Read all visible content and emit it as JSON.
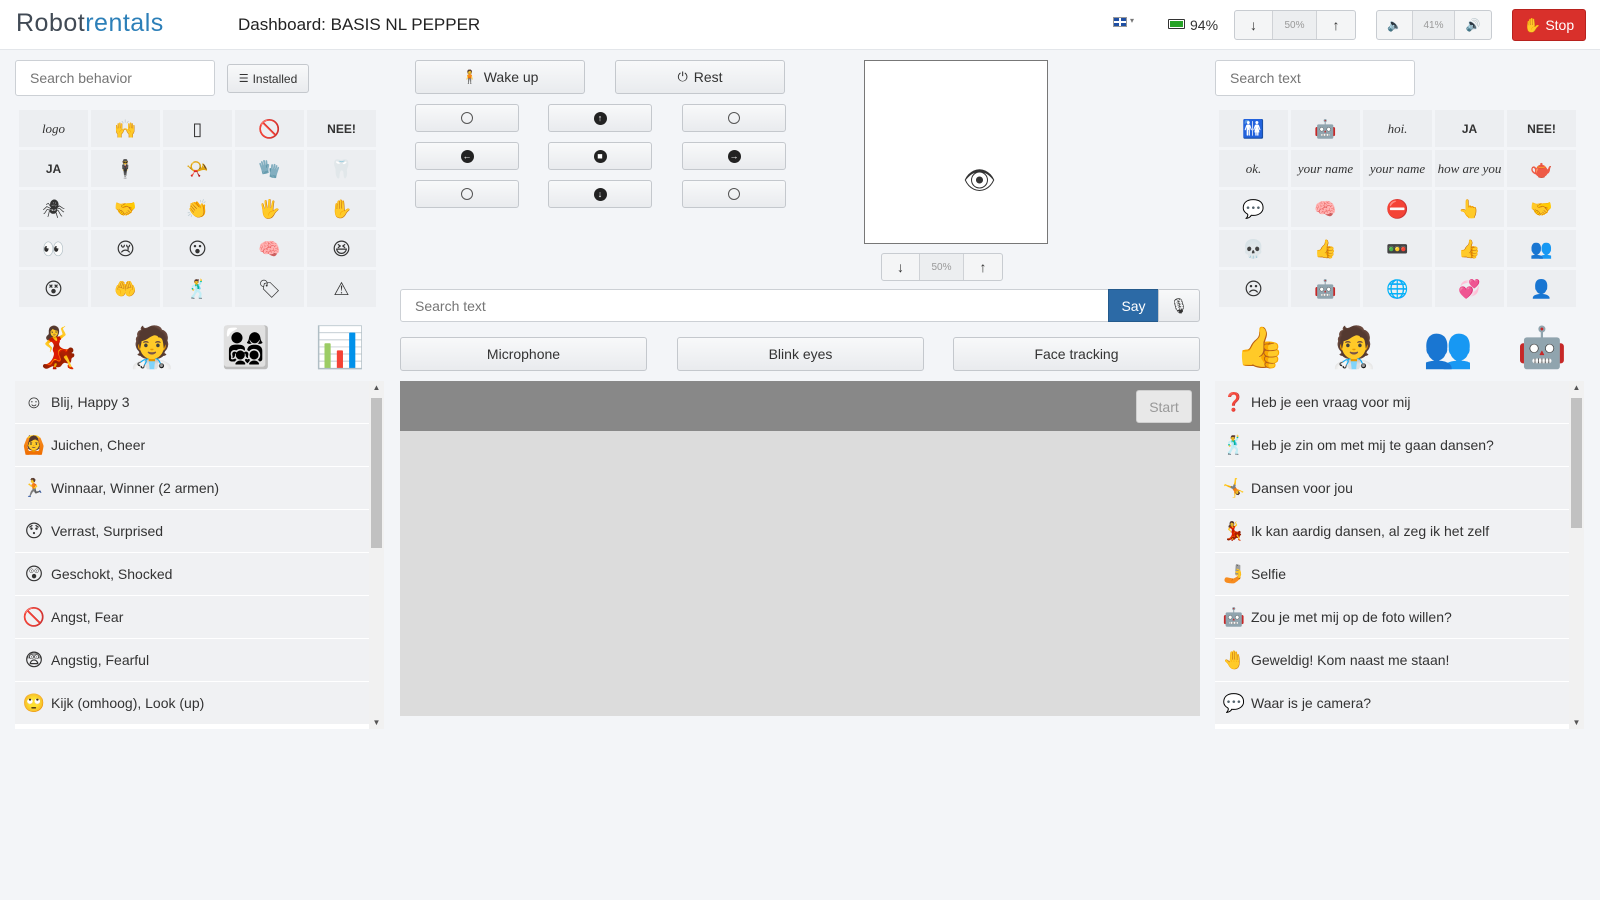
{
  "header": {
    "logo_part1": "Robot",
    "logo_part2": "rentals",
    "title": "Dashboard: BASIS NL PEPPER",
    "battery_percent": "94%",
    "head_tilt_value": "50%",
    "volume_value": "41%",
    "stop_label": "Stop"
  },
  "left": {
    "search_placeholder": "Search behavior",
    "installed_label": "Installed",
    "grid": [
      {
        "icon": "logo-icon",
        "kind": "script",
        "text": "logo"
      },
      {
        "icon": "arms-up-robot-icon",
        "kind": "glyph",
        "text": "🙌"
      },
      {
        "icon": "tablet-icon",
        "kind": "glyph",
        "text": "▯"
      },
      {
        "icon": "forbidden-icon",
        "kind": "glyph",
        "text": "🚫"
      },
      {
        "icon": "nee-icon",
        "kind": "txt",
        "text": "NEE!"
      },
      {
        "icon": "ja-icon",
        "kind": "txt",
        "text": "JA"
      },
      {
        "icon": "person-arms-out-icon",
        "kind": "glyph",
        "text": "🕴"
      },
      {
        "icon": "whistle-icon",
        "kind": "glyph",
        "text": "📯"
      },
      {
        "icon": "hands-icon",
        "kind": "glyph",
        "text": "🧤"
      },
      {
        "icon": "teeth-icon",
        "kind": "glyph",
        "text": "🦷"
      },
      {
        "icon": "bug-icon",
        "kind": "glyph",
        "text": "🕷"
      },
      {
        "icon": "handshake-icon",
        "kind": "glyph",
        "text": "🤝"
      },
      {
        "icon": "clap-hand-icon",
        "kind": "glyph",
        "text": "👏"
      },
      {
        "icon": "wave-hand-icon",
        "kind": "glyph",
        "text": "🖐"
      },
      {
        "icon": "open-hand-icon",
        "kind": "glyph",
        "text": "✋"
      },
      {
        "icon": "eyes-icon",
        "kind": "glyph",
        "text": "👀"
      },
      {
        "icon": "crying-face-icon",
        "kind": "glyph",
        "text": "😢"
      },
      {
        "icon": "orange-face-icon",
        "kind": "glyph",
        "text": "😮"
      },
      {
        "icon": "brain-icon",
        "kind": "glyph",
        "text": "🧠"
      },
      {
        "icon": "laughing-face-icon",
        "kind": "glyph",
        "text": "😆"
      },
      {
        "icon": "blue-face-icon",
        "kind": "glyph",
        "text": "😵"
      },
      {
        "icon": "handshake-hands-icon",
        "kind": "glyph",
        "text": "🤲"
      },
      {
        "icon": "person-stand-icon",
        "kind": "glyph",
        "text": "🕺"
      },
      {
        "icon": "sign-icon",
        "kind": "glyph",
        "text": "🏷"
      },
      {
        "icon": "warning-icon",
        "kind": "glyph",
        "text": "⚠"
      }
    ],
    "big_icons": [
      {
        "icon": "dancing-couple-icon",
        "text": "💃"
      },
      {
        "icon": "doctor-patient-icon",
        "text": "🧑‍⚕️"
      },
      {
        "icon": "group-people-icon",
        "text": "👨‍👩‍👧‍👦"
      },
      {
        "icon": "presentation-icon",
        "text": "📊"
      }
    ],
    "list": [
      {
        "icon": "happy-face-icon",
        "glyph": "☺",
        "label": "Blij, Happy 3"
      },
      {
        "icon": "cheer-icon",
        "glyph": "🙆",
        "label": "Juichen, Cheer"
      },
      {
        "icon": "winner-icon",
        "glyph": "🏃",
        "label": "Winnaar, Winner (2 armen)"
      },
      {
        "icon": "surprised-face-icon",
        "glyph": "😯",
        "label": "Verrast, Surprised"
      },
      {
        "icon": "shocked-face-icon",
        "glyph": "😲",
        "label": "Geschokt, Shocked"
      },
      {
        "icon": "fear-icon",
        "glyph": "🚫",
        "label": "Angst, Fear"
      },
      {
        "icon": "fearful-face-icon",
        "glyph": "😨",
        "label": "Angstig, Fearful"
      },
      {
        "icon": "look-up-face-icon",
        "glyph": "🙄",
        "label": "Kijk (omhoog), Look (up)"
      }
    ]
  },
  "center": {
    "wake_up_label": "Wake up",
    "rest_label": "Rest",
    "camera_zoom_value": "50%",
    "say_placeholder": "Search text",
    "say_label": "Say",
    "microphone_label": "Microphone",
    "blink_eyes_label": "Blink eyes",
    "face_tracking_label": "Face tracking",
    "start_label": "Start"
  },
  "right": {
    "search_placeholder": "Search text",
    "grid": [
      {
        "icon": "couple-icon",
        "kind": "glyph",
        "text": "🚻"
      },
      {
        "icon": "robot-desk-icon",
        "kind": "glyph",
        "text": "🤖"
      },
      {
        "icon": "hoi-icon",
        "kind": "script",
        "text": "hoi."
      },
      {
        "icon": "ja-icon",
        "kind": "txt",
        "text": "JA"
      },
      {
        "icon": "nee-icon",
        "kind": "txt",
        "text": "NEE!"
      },
      {
        "icon": "ok-icon",
        "kind": "script",
        "text": "ok."
      },
      {
        "icon": "your-name-icon",
        "kind": "script",
        "text": "your name"
      },
      {
        "icon": "your-name-red-icon",
        "kind": "script",
        "text": "your name"
      },
      {
        "icon": "how-are-you-icon",
        "kind": "script",
        "text": "how are you"
      },
      {
        "icon": "teapot-icon",
        "kind": "glyph",
        "text": "🫖"
      },
      {
        "icon": "speech-icon",
        "kind": "glyph",
        "text": "💬"
      },
      {
        "icon": "brain-outline-icon",
        "kind": "glyph",
        "text": "🧠"
      },
      {
        "icon": "no-sign-icon",
        "kind": "glyph",
        "text": "⛔"
      },
      {
        "icon": "pointing-hand-icon",
        "kind": "glyph",
        "text": "👆"
      },
      {
        "icon": "handshake-icon",
        "kind": "glyph",
        "text": "🤝"
      },
      {
        "icon": "skull-icon",
        "kind": "glyph",
        "text": "💀"
      },
      {
        "icon": "thumbs-up-icon",
        "kind": "glyph",
        "text": "👍"
      },
      {
        "icon": "traffic-light-icon",
        "kind": "glyph",
        "text": "🚥"
      },
      {
        "icon": "like-icon",
        "kind": "glyph",
        "text": "👍"
      },
      {
        "icon": "group-face-icon",
        "kind": "glyph",
        "text": "👥"
      },
      {
        "icon": "sad-face-icon",
        "kind": "glyph",
        "text": "☹"
      },
      {
        "icon": "robot-small-icon",
        "kind": "glyph",
        "text": "🤖"
      },
      {
        "icon": "globe-icon",
        "kind": "glyph",
        "text": "🌐"
      },
      {
        "icon": "heart-brain-icon",
        "kind": "glyph",
        "text": "💞"
      },
      {
        "icon": "robot-outline-icon",
        "kind": "glyph",
        "text": "👤"
      }
    ],
    "big_icons": [
      {
        "icon": "thumbs-up-big-icon",
        "text": "👍"
      },
      {
        "icon": "doctor-patient-icon",
        "text": "🧑‍⚕️"
      },
      {
        "icon": "faces-icon",
        "text": "👥"
      },
      {
        "icon": "robot-big-icon",
        "text": "🤖"
      }
    ],
    "list": [
      {
        "icon": "question-icon",
        "glyph": "❓",
        "label": "Heb je een vraag voor mij"
      },
      {
        "icon": "dance-icon",
        "glyph": "🕺",
        "label": "Heb je zin om met mij te gaan dansen?"
      },
      {
        "icon": "kick-icon",
        "glyph": "🤸",
        "label": "Dansen voor jou"
      },
      {
        "icon": "dancing-icon",
        "glyph": "💃",
        "label": "Ik kan aardig dansen, al zeg ik het zelf"
      },
      {
        "icon": "selfie-icon",
        "glyph": "🤳",
        "label": "Selfie"
      },
      {
        "icon": "photo-robot-icon",
        "glyph": "🤖",
        "label": "Zou je met mij op de foto willen?"
      },
      {
        "icon": "hand-icon",
        "glyph": "🤚",
        "label": "Geweldig! Kom naast me staan!"
      },
      {
        "icon": "speech-bubble-icon",
        "glyph": "💬",
        "label": "Waar is je camera?"
      }
    ]
  }
}
